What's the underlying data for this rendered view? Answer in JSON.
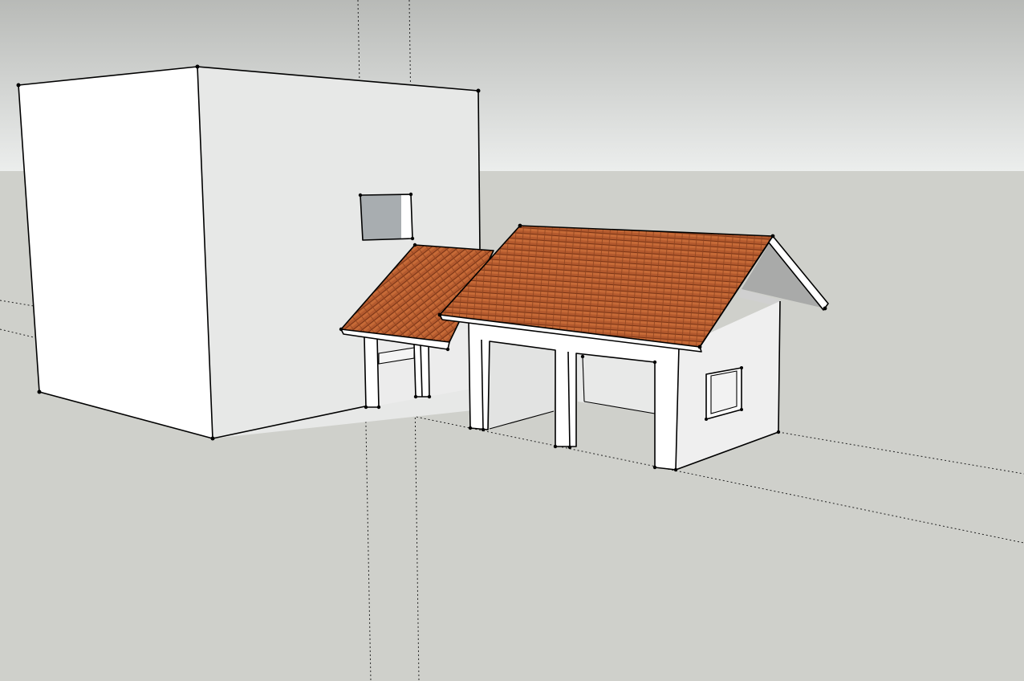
{
  "viewport": {
    "tool": "select-tool",
    "sky_top_color": "#b8bab7",
    "sky_bottom_color": "#eceeed",
    "ground_color": "#cfd0cb",
    "face_light_color": "#ffffff",
    "face_shade_color": "#e7e8e7",
    "face_back_color": "#a9aaa9",
    "glass_color": "#a8adb0",
    "roof_color": "#b45a2e",
    "roof_tile_line_color": "#7a3416",
    "edge_color": "#000000"
  },
  "scene": {
    "objects": [
      {
        "name": "main-building",
        "kind": "box"
      },
      {
        "name": "main-building-window",
        "kind": "window"
      },
      {
        "name": "lean-to-roof",
        "kind": "roof",
        "material": "roof-tiles"
      },
      {
        "name": "garage-gable-roof",
        "kind": "roof",
        "material": "roof-tiles"
      },
      {
        "name": "garage-body",
        "kind": "box"
      },
      {
        "name": "garage-side-window",
        "kind": "window"
      }
    ]
  }
}
